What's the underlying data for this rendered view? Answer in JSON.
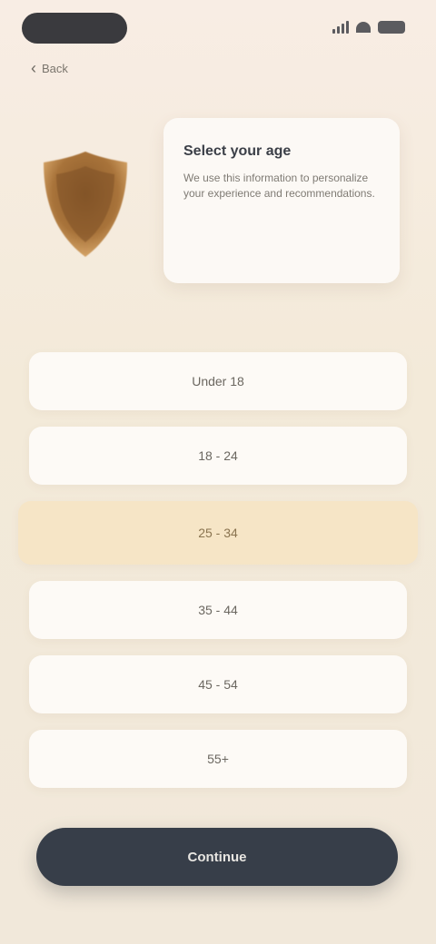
{
  "status_bar": {
    "icons": [
      "signal-icon",
      "wifi-icon",
      "battery-icon"
    ]
  },
  "nav": {
    "back_label": "Back",
    "back_icon": "chevron-left-icon"
  },
  "intro": {
    "icon": "shield-icon",
    "title": "Select your age",
    "text": "We use this information to personalize your experience and recommendations."
  },
  "options": [
    {
      "label": "Under 18",
      "selected": false
    },
    {
      "label": "18 - 24",
      "selected": false
    },
    {
      "label": "25 - 34",
      "selected": true
    },
    {
      "label": "35 - 44",
      "selected": false
    },
    {
      "label": "45 - 54",
      "selected": false
    },
    {
      "label": "55+",
      "selected": false
    }
  ],
  "submit": {
    "label": "Continue"
  },
  "colors": {
    "background": "#f3ead9",
    "card": "#fcf9f5",
    "selected": "#f6e5c6",
    "button": "#373e49",
    "shield": "#a8733a"
  }
}
